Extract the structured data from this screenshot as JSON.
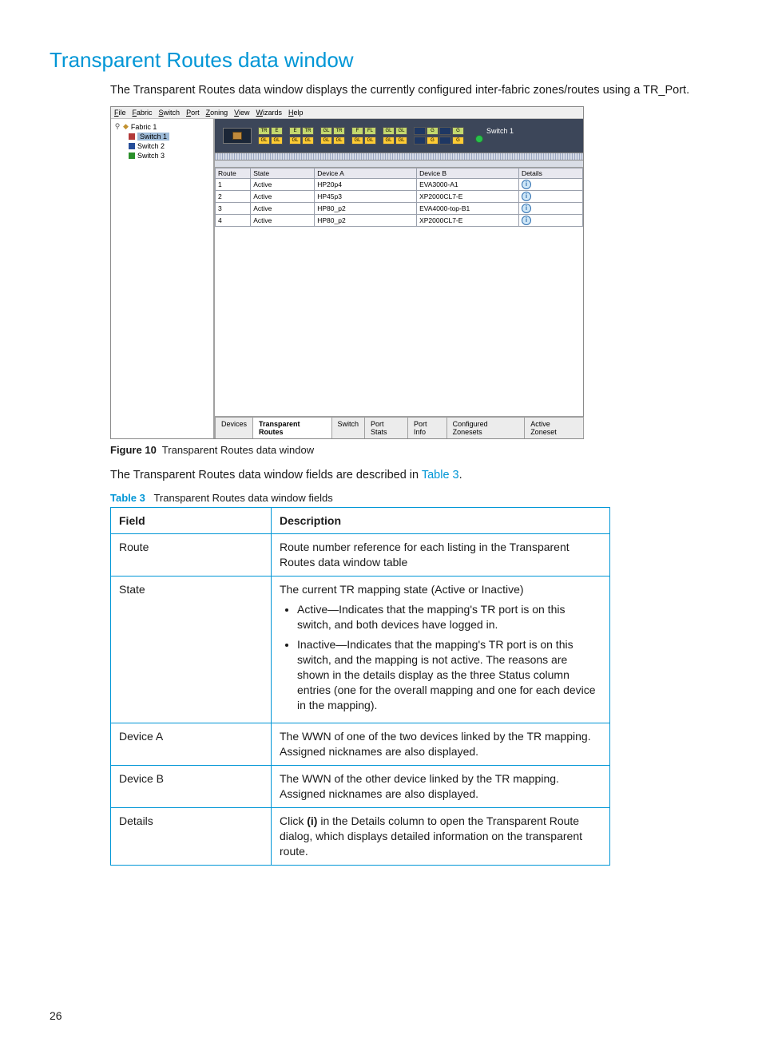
{
  "title": "Transparent Routes data window",
  "intro": "The Transparent Routes data window displays the currently configured inter-fabric zones/routes using a TR_Port.",
  "menubar": [
    "File",
    "Fabric",
    "Switch",
    "Port",
    "Zoning",
    "View",
    "Wizards",
    "Help"
  ],
  "tree": {
    "root": "Fabric 1",
    "items": [
      {
        "label": "Switch 1",
        "selected": true,
        "color": "#b23a3a"
      },
      {
        "label": "Switch 2",
        "selected": false,
        "color": "#264e99"
      },
      {
        "label": "Switch 3",
        "selected": false,
        "color": "#2a8f2a"
      }
    ]
  },
  "port_strip": {
    "groups": [
      {
        "top": [
          {
            "t": "TR",
            "c": "#c5d86d"
          },
          {
            "t": "E",
            "c": "#c5d86d"
          }
        ],
        "bot": [
          {
            "t": "GL",
            "c": "#ffcc33"
          },
          {
            "t": "GL",
            "c": "#ffcc33"
          }
        ]
      },
      {
        "top": [
          {
            "t": "E",
            "c": "#c5d86d"
          },
          {
            "t": "TR",
            "c": "#c5d86d"
          }
        ],
        "bot": [
          {
            "t": "GL",
            "c": "#ffcc33"
          },
          {
            "t": "GL",
            "c": "#ffcc33"
          }
        ]
      },
      {
        "top": [
          {
            "t": "GL",
            "c": "#c5d86d"
          },
          {
            "t": "TR",
            "c": "#c5d86d"
          }
        ],
        "bot": [
          {
            "t": "GL",
            "c": "#ffcc33"
          },
          {
            "t": "GL",
            "c": "#ffcc33"
          }
        ]
      },
      {
        "top": [
          {
            "t": "F",
            "c": "#c5d86d"
          },
          {
            "t": "FL",
            "c": "#c5d86d"
          }
        ],
        "bot": [
          {
            "t": "GL",
            "c": "#ffcc33"
          },
          {
            "t": "GL",
            "c": "#ffcc33"
          }
        ]
      },
      {
        "top": [
          {
            "t": "GL",
            "c": "#c5d86d"
          },
          {
            "t": "GL",
            "c": "#c5d86d"
          }
        ],
        "bot": [
          {
            "t": "GL",
            "c": "#ffcc33"
          },
          {
            "t": "GL",
            "c": "#ffcc33"
          }
        ]
      },
      {
        "top": [
          {
            "t": "",
            "c": "#1e3763"
          },
          {
            "t": "G",
            "c": "#c5d86d"
          },
          {
            "t": "",
            "c": "#1e3763"
          },
          {
            "t": "G",
            "c": "#c5d86d"
          }
        ],
        "bot": [
          {
            "t": "",
            "c": "#1e3763"
          },
          {
            "t": "G",
            "c": "#ffcc33"
          },
          {
            "t": "",
            "c": "#1e3763"
          },
          {
            "t": "G",
            "c": "#ffcc33"
          }
        ]
      }
    ],
    "switch_label": "Switch 1"
  },
  "routes_headers": [
    "Route",
    "State",
    "Device A",
    "Device B",
    "Details"
  ],
  "routes": [
    {
      "route": "1",
      "state": "Active",
      "devA": "HP20p4",
      "devB": "EVA3000-A1"
    },
    {
      "route": "2",
      "state": "Active",
      "devA": "HP45p3",
      "devB": "XP2000CL7-E"
    },
    {
      "route": "3",
      "state": "Active",
      "devA": "HP80_p2",
      "devB": "EVA4000-top-B1"
    },
    {
      "route": "4",
      "state": "Active",
      "devA": "HP80_p2",
      "devB": "XP2000CL7-E"
    }
  ],
  "tabs": [
    "Devices",
    "Transparent Routes",
    "Switch",
    "Port Stats",
    "Port Info",
    "Configured Zonesets",
    "Active Zoneset"
  ],
  "active_tab": 1,
  "figure_caption_label": "Figure 10",
  "figure_caption_text": "Transparent Routes data window",
  "para2_before": "The Transparent Routes data window fields are described in ",
  "para2_link": "Table 3",
  "para2_after": ".",
  "table_caption_label": "Table 3",
  "table_caption_text": "Transparent Routes data window fields",
  "fieldtable": {
    "headers": [
      "Field",
      "Description"
    ],
    "rows": [
      {
        "field": "Route",
        "desc": "Route number reference for each listing in the Transparent Routes data window table"
      },
      {
        "field": "State",
        "desc": "The current TR mapping state (Active or Inactive)",
        "bullets": [
          "Active—Indicates that the mapping's TR port is on this switch, and both devices have logged in.",
          "Inactive—Indicates that the mapping's TR port is on this switch, and the mapping is not active. The reasons are shown in the details display as the three Status column entries (one for the overall mapping and one for each device in the mapping)."
        ]
      },
      {
        "field": "Device A",
        "desc": "The WWN of one of the two devices linked by the TR mapping. Assigned nicknames are also displayed."
      },
      {
        "field": "Device B",
        "desc": "The WWN of the other device linked by the TR mapping. Assigned nicknames are also displayed."
      },
      {
        "field": "Details",
        "desc_pre": "Click ",
        "desc_bold": "(i)",
        "desc_post": " in the Details column to open the Transparent Route dialog, which displays detailed information on the transparent route."
      }
    ]
  },
  "page_no": "26"
}
